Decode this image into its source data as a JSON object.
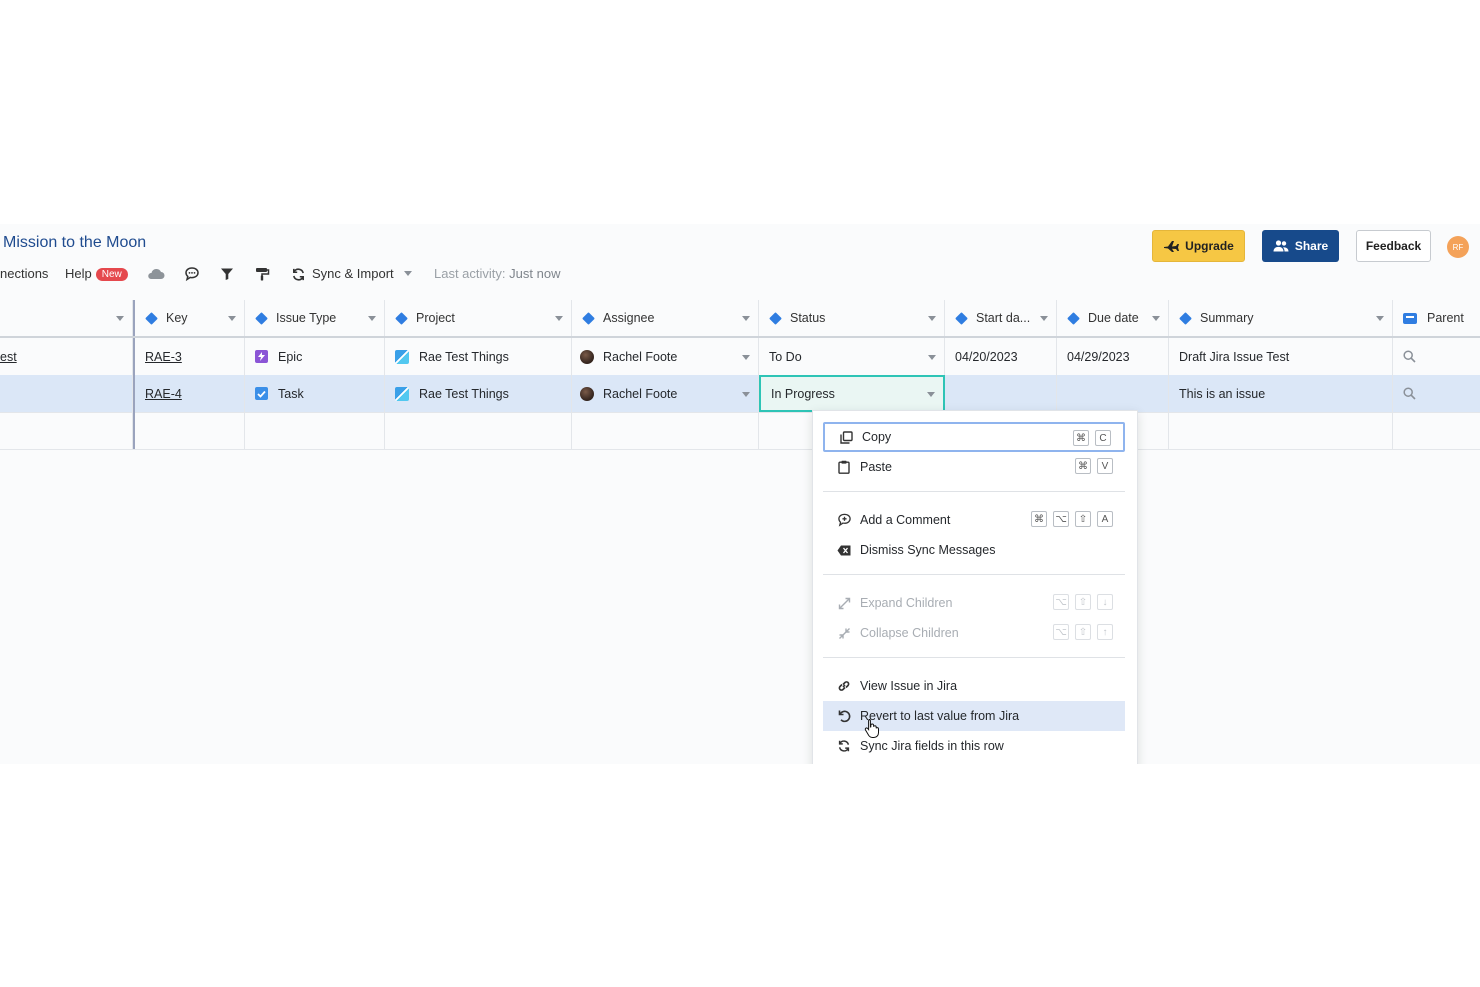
{
  "header": {
    "title": "Mission to the Moon",
    "toolbar": {
      "connections": "nections",
      "help": "Help",
      "help_badge": "New",
      "sync_import": "Sync & Import",
      "last_activity_label": "Last activity:",
      "last_activity_value": "Just now"
    },
    "buttons": {
      "upgrade": "Upgrade",
      "share": "Share",
      "feedback": "Feedback"
    },
    "avatar_initials": "RF"
  },
  "grid": {
    "columns": {
      "key": "Key",
      "issue_type": "Issue Type",
      "project": "Project",
      "assignee": "Assignee",
      "status": "Status",
      "start_date": "Start da...",
      "due_date": "Due date",
      "summary": "Summary",
      "parent": "Parent"
    },
    "rows": [
      {
        "first": "est",
        "key": "RAE-3",
        "issue_type": "Epic",
        "project": "Rae Test Things",
        "assignee": "Rachel Foote",
        "status": "To Do",
        "start_date": "04/20/2023",
        "due_date": "04/29/2023",
        "summary": "Draft Jira Issue Test"
      },
      {
        "first": "",
        "key": "RAE-4",
        "issue_type": "Task",
        "project": "Rae Test Things",
        "assignee": "Rachel Foote",
        "status": "In Progress",
        "start_date": "",
        "due_date": "",
        "summary": "This is an issue"
      }
    ]
  },
  "context_menu": {
    "copy": "Copy",
    "copy_keys": [
      "⌘",
      "C"
    ],
    "paste": "Paste",
    "paste_keys": [
      "⌘",
      "V"
    ],
    "add_comment": "Add a Comment",
    "add_comment_keys": [
      "⌘",
      "⌥",
      "⇧",
      "A"
    ],
    "dismiss_sync": "Dismiss Sync Messages",
    "expand_children": "Expand Children",
    "expand_keys": [
      "⌥",
      "⇧",
      "↓"
    ],
    "collapse_children": "Collapse Children",
    "collapse_keys": [
      "⌥",
      "⇧",
      "↑"
    ],
    "view_in_jira": "View Issue in Jira",
    "revert": "Revert to last value from Jira",
    "sync_row": "Sync Jira fields in this row"
  },
  "colors": {
    "accent": "#2f7de1",
    "title": "#1f4b8f",
    "upgrade": "#f6c744",
    "share": "#174a8b",
    "selected_row": "#dbe7f7"
  }
}
